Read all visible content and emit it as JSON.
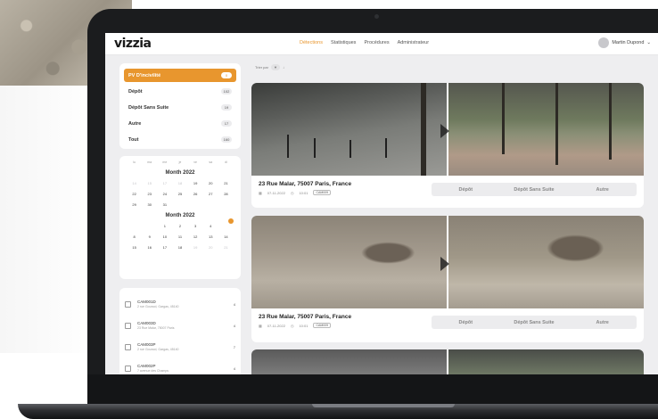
{
  "brand": {
    "logo": "vizzia",
    "accent": "#e8962e"
  },
  "nav": {
    "items": [
      "Détections",
      "Statistiques",
      "Procédures",
      "Administrateur"
    ],
    "active": 0
  },
  "user": {
    "name": "Martin Dupond"
  },
  "filters": [
    {
      "label": "PV D'incivilité",
      "count": "0",
      "active": true
    },
    {
      "label": "Dépôt",
      "count": "102"
    },
    {
      "label": "Dépôt Sans Suite",
      "count": "19"
    },
    {
      "label": "Autre",
      "count": "17"
    },
    {
      "label": "Tout",
      "count": "160"
    }
  ],
  "calendar": {
    "weekdays": [
      "lu",
      "ma",
      "me",
      "je",
      "ve",
      "sa",
      "di"
    ],
    "months": [
      {
        "label": "Month 2022"
      },
      {
        "label": "Month 2022"
      }
    ]
  },
  "sort": {
    "label": "Trier par"
  },
  "cameras": [
    {
      "name": "CAM001D",
      "address": "2 rue Gounod, Gargas, 45140",
      "count": "4"
    },
    {
      "name": "CAM003D",
      "address": "23 Rue Malar, 75007 Paris",
      "count": "4"
    },
    {
      "name": "CAM003P",
      "address": "2 rue Gounod, Gargas, 45140",
      "count": "7"
    },
    {
      "name": "CAM002P",
      "address": "7 avenue des Champs",
      "count": "4"
    }
  ],
  "detections": [
    {
      "address": "23 Rue Malar, 75007 Paris, France",
      "date": "07-11-2022",
      "time": "10:01",
      "camera": "CAM009",
      "actions": [
        "Dépôt",
        "Dépôt Sans Suite",
        "Autre"
      ]
    },
    {
      "address": "23 Rue Malar, 75007 Paris, France",
      "date": "07-11-2022",
      "time": "10:01",
      "camera": "CAM009",
      "actions": [
        "Dépôt",
        "Dépôt Sans Suite",
        "Autre"
      ]
    }
  ]
}
